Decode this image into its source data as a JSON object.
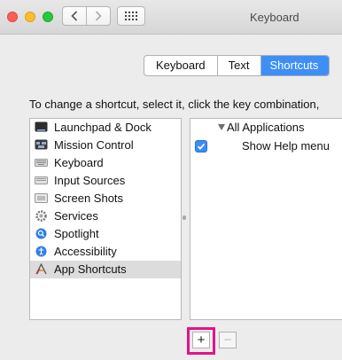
{
  "window": {
    "title": "Keyboard"
  },
  "toolbar": {
    "back_icon": "chevron-left-icon",
    "forward_icon": "chevron-right-icon",
    "grid_icon": "show-all-grid-icon"
  },
  "tabs": [
    {
      "label": "Keyboard",
      "selected": false
    },
    {
      "label": "Text",
      "selected": false
    },
    {
      "label": "Shortcuts",
      "selected": true
    }
  ],
  "instruction": "To change a shortcut, select it, click the key combination,",
  "categories": [
    {
      "label": "Launchpad & Dock",
      "icon": "launchpad-dock-icon"
    },
    {
      "label": "Mission Control",
      "icon": "mission-control-icon"
    },
    {
      "label": "Keyboard",
      "icon": "keyboard-icon"
    },
    {
      "label": "Input Sources",
      "icon": "input-sources-icon"
    },
    {
      "label": "Screen Shots",
      "icon": "screen-shots-icon"
    },
    {
      "label": "Services",
      "icon": "services-gear-icon"
    },
    {
      "label": "Spotlight",
      "icon": "spotlight-icon"
    },
    {
      "label": "Accessibility",
      "icon": "accessibility-icon"
    },
    {
      "label": "App Shortcuts",
      "icon": "app-shortcuts-icon",
      "selected": true
    }
  ],
  "shortcuts": {
    "group_label": "All Applications",
    "items": [
      {
        "label": "Show Help menu",
        "checked": true
      }
    ]
  },
  "buttons": {
    "add_label": "+",
    "remove_label": "−"
  },
  "colors": {
    "accent": "#3d8ff7",
    "highlight": "#e2138b"
  }
}
